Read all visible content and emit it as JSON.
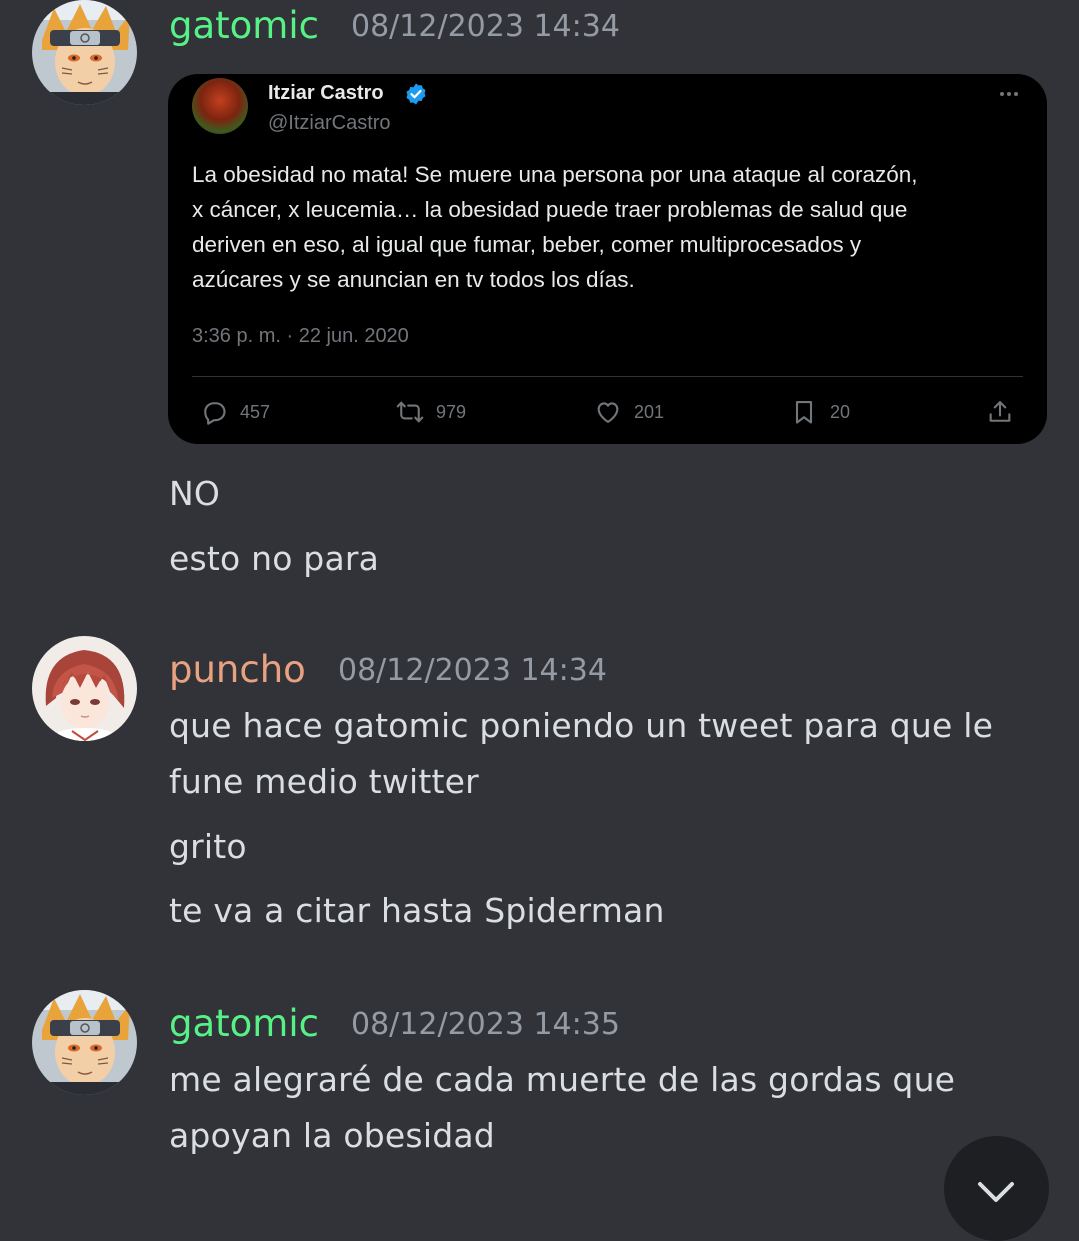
{
  "colors": {
    "background": "#313338",
    "gatomic_name": "#57f287",
    "puncho_name": "#e8a281",
    "message_text": "#dbdee1",
    "timestamp": "#949ba4",
    "tweet_bg": "#000000",
    "verified": "#1d9bf0"
  },
  "messages": [
    {
      "author": "gatomic",
      "timestamp": "08/12/2023 14:34",
      "embed": {
        "name": "Itziar Castro",
        "handle": "@ItziarCastro",
        "verified_icon": "verified-badge-icon",
        "body_lines": [
          "La obesidad no mata! Se muere una persona por una ataque al corazón,",
          "x cáncer, x leucemia… la obesidad puede traer problemas de salud que",
          "deriven en eso, al igual que fumar, beber, comer multiprocesados y",
          "azúcares y se anuncian en tv todos los días."
        ],
        "date": "3:36 p. m. · 22 jun. 2020",
        "replies": "457",
        "retweets": "979",
        "likes": "201",
        "bookmarks": "20"
      },
      "lines": [
        "NO",
        "esto no para"
      ]
    },
    {
      "author": "puncho",
      "timestamp": "08/12/2023 14:34",
      "lines": [
        "que hace gatomic poniendo un tweet para que le",
        "fune medio twitter",
        "grito",
        "te va a citar hasta Spiderman"
      ]
    },
    {
      "author": "gatomic",
      "timestamp": "08/12/2023 14:35",
      "lines": [
        "me alegraré de cada muerte de las gordas que",
        "apoyan la obesidad"
      ]
    }
  ]
}
